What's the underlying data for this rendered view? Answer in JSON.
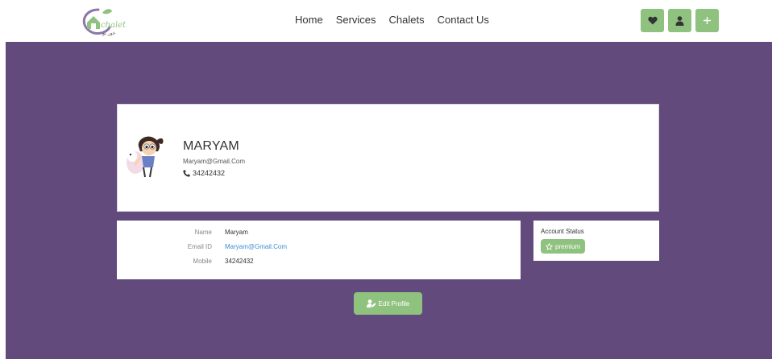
{
  "header": {
    "logo_text": "chalet",
    "logo_subtext": "خور يو",
    "nav": [
      {
        "label": "Home"
      },
      {
        "label": "Services"
      },
      {
        "label": "Chalets"
      },
      {
        "label": "Contact Us"
      }
    ],
    "actions": [
      {
        "icon": "heart-icon"
      },
      {
        "icon": "user-icon"
      },
      {
        "icon": "plus-icon"
      }
    ]
  },
  "profile": {
    "name": "MARYAM",
    "email": "Maryam@Gmail.Com",
    "phone": "34242432"
  },
  "details": {
    "rows": [
      {
        "label": "Name",
        "value": "Maryam"
      },
      {
        "label": "Email ID",
        "value": "Maryam@Gmail.Com"
      },
      {
        "label": "Mobile",
        "value": "34242432"
      }
    ]
  },
  "account": {
    "title": "Account Status",
    "badge": "premium"
  },
  "edit_button": {
    "label": "Edit Profile"
  },
  "colors": {
    "accent": "#8fc27f",
    "background": "#624a7c",
    "link": "#3a8fd6"
  }
}
